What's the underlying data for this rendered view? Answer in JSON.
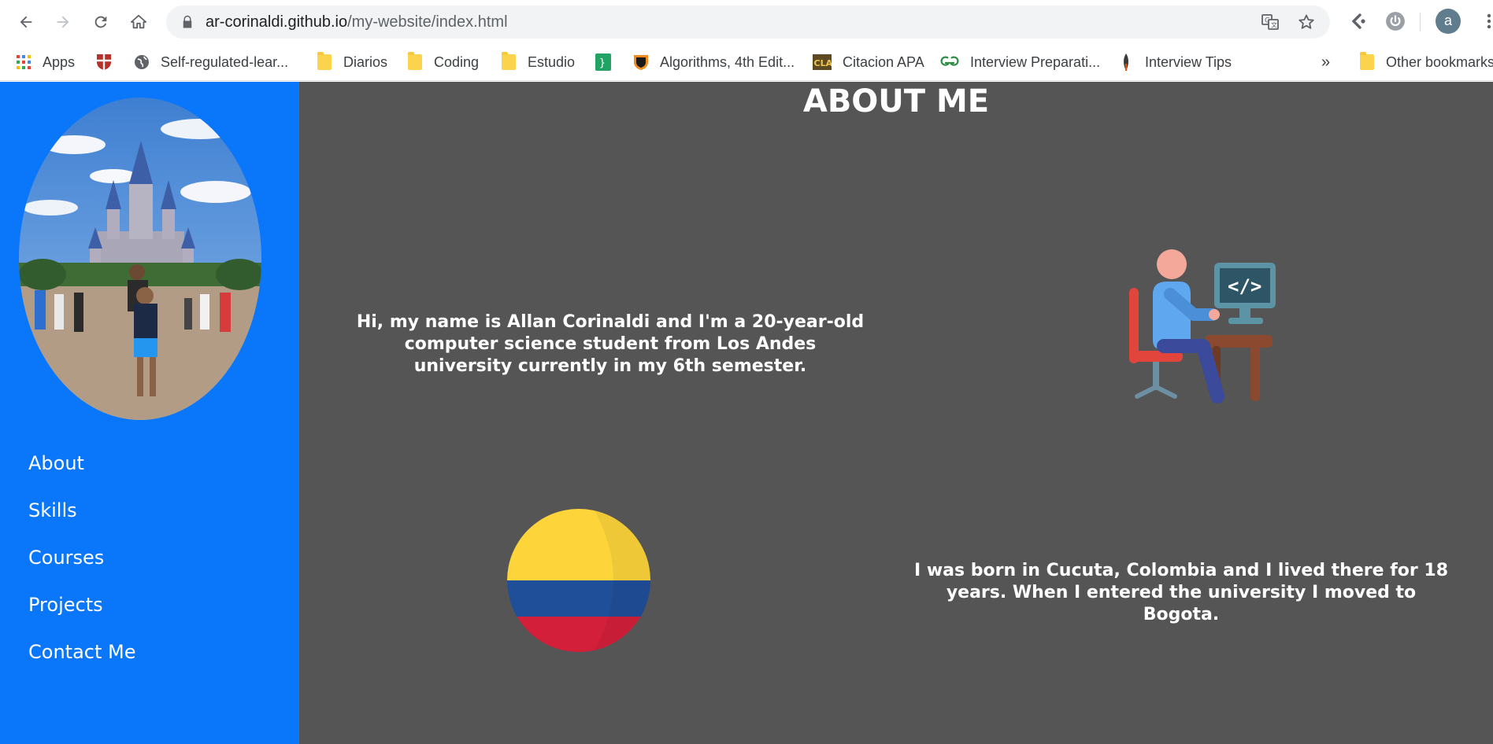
{
  "browser": {
    "url_domain": "ar-corinaldi.github.io",
    "url_path": "/my-website/index.html",
    "avatar_letter": "a",
    "bookmarks": [
      {
        "label": "Apps",
        "icon": "apps-grid-icon"
      },
      {
        "label": "Self-regulated-lear...",
        "icon": "crest-icon"
      },
      {
        "label": "Diarios",
        "icon": "folder-icon"
      },
      {
        "label": "Coding",
        "icon": "folder-icon"
      },
      {
        "label": "Estudio",
        "icon": "folder-icon"
      },
      {
        "label": "",
        "icon": "green-bracket-icon"
      },
      {
        "label": "Algorithms, 4th Edit...",
        "icon": "shield-icon"
      },
      {
        "label": "Citacion APA",
        "icon": "cla-icon"
      },
      {
        "label": "Interview Preparati...",
        "icon": "gfg-icon"
      },
      {
        "label": "Interview Tips",
        "icon": "quill-icon"
      }
    ],
    "overflow_label": "»",
    "other_bookmarks": "Other bookmarks"
  },
  "sidebar": {
    "nav": [
      "About",
      "Skills",
      "Courses",
      "Projects",
      "Contact Me"
    ]
  },
  "main": {
    "title": "ABOUT ME",
    "intro": "Hi, my name is Allan Corinaldi and I'm a 20-year-old computer science student from Los Andes university currently in my 6th semester.",
    "origin": "I was born in Cucuta, Colombia and I lived there for 18 years. When I entered the university I moved to Bogota.",
    "coder_code_label": "</>"
  },
  "colors": {
    "sidebar": "#0a77fa",
    "main_bg": "#555555",
    "flag_yellow": "#fdd53b",
    "flag_blue": "#1f4f99",
    "flag_red": "#d41f3b"
  }
}
